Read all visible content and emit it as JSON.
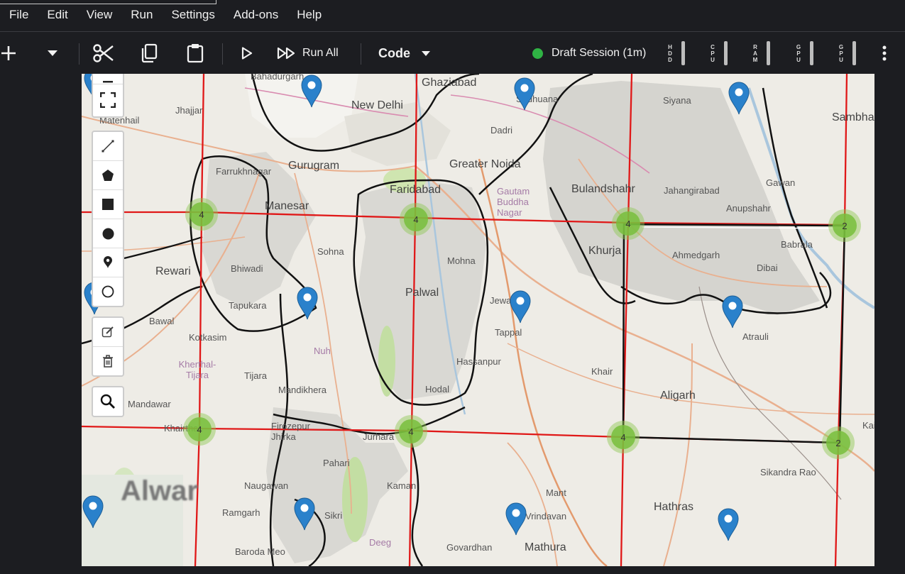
{
  "menu": [
    "File",
    "Edit",
    "View",
    "Run",
    "Settings",
    "Add-ons",
    "Help"
  ],
  "toolbar": {
    "run_all_label": "Run All",
    "cell_type": "Code",
    "session_label": "Draft Session (1m)",
    "status_color": "#2fb344",
    "meters": [
      "HDD",
      "CPU",
      "RAM",
      "GPU",
      "GPU"
    ]
  },
  "map": {
    "place_labels": [
      {
        "text": "Bahadurgarh"
      },
      {
        "text": "Ghaziabad"
      },
      {
        "text": "New Delhi"
      },
      {
        "text": "Jhajjar"
      },
      {
        "text": "Matenhail"
      },
      {
        "text": "Farrukhnagar"
      },
      {
        "text": "Gurugram"
      },
      {
        "text": "Greater Noida"
      },
      {
        "text": "Faridabad"
      },
      {
        "text": "Manesar"
      },
      {
        "text": "Dadri"
      },
      {
        "text": "Bulandshahr"
      },
      {
        "text": "Jahangirabad"
      },
      {
        "text": "Siyana"
      },
      {
        "text": "Gawan"
      },
      {
        "text": "Sambhal"
      },
      {
        "text": "Anupshahr"
      },
      {
        "text": "Babrala"
      },
      {
        "text": "Ahmedgarh"
      },
      {
        "text": "Dibai"
      },
      {
        "text": "Khurja"
      },
      {
        "text": "Rewari"
      },
      {
        "text": "Bhiwadi"
      },
      {
        "text": "Sohna"
      },
      {
        "text": "Palwal"
      },
      {
        "text": "Mohna"
      },
      {
        "text": "Tapukara"
      },
      {
        "text": "Bawal"
      },
      {
        "text": "Jewar"
      },
      {
        "text": "Tappal"
      },
      {
        "text": "Atrauli"
      },
      {
        "text": "Kotkasim"
      },
      {
        "text": "Nuh"
      },
      {
        "text": "Hassanpur"
      },
      {
        "text": "Khair"
      },
      {
        "text": "Kherthal-Tijara"
      },
      {
        "text": "Tijara"
      },
      {
        "text": "Mandikhera"
      },
      {
        "text": "Hodal"
      },
      {
        "text": "Aligarh"
      },
      {
        "text": "Mandawar"
      },
      {
        "text": "Firozepur Jhirka"
      },
      {
        "text": "Jurhara"
      },
      {
        "text": "Pahari"
      },
      {
        "text": "Kaman"
      },
      {
        "text": "Sikandra Rao"
      },
      {
        "text": "Naugawan"
      },
      {
        "text": "Mant"
      },
      {
        "text": "Ramgarh"
      },
      {
        "text": "Sikri"
      },
      {
        "text": "Vrindavan"
      },
      {
        "text": "Hathras"
      },
      {
        "text": "Deeg"
      },
      {
        "text": "Govardhan"
      },
      {
        "text": "Mathura"
      },
      {
        "text": "Baroda Meo"
      },
      {
        "text": "Gautam Buddha Nagar"
      },
      {
        "text": "Alwar"
      },
      {
        "text": "Kaimganj"
      },
      {
        "text": "Sadhuana"
      },
      {
        "text": "Khairthal"
      }
    ],
    "clusters": [
      {
        "count": "4"
      },
      {
        "count": "4"
      },
      {
        "count": "4"
      },
      {
        "count": "2"
      },
      {
        "count": "4"
      },
      {
        "count": "4"
      },
      {
        "count": "4"
      },
      {
        "count": "2"
      }
    ],
    "marker_color": "#2a81cb"
  }
}
